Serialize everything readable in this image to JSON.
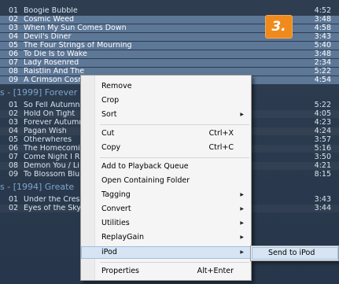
{
  "album1": {
    "tracks": [
      {
        "num": "01",
        "title": "Boogie Bubble",
        "time": "4:52"
      },
      {
        "num": "02",
        "title": "Cosmic Weed",
        "time": "3:48"
      },
      {
        "num": "03",
        "title": "When My Sun Comes Down",
        "time": "4:58"
      },
      {
        "num": "04",
        "title": "Devil's Diner",
        "time": "3:43"
      },
      {
        "num": "05",
        "title": "The Four Strings of Mourning",
        "time": "5:40"
      },
      {
        "num": "06",
        "title": "To Die Is to Wake",
        "time": "3:48"
      },
      {
        "num": "07",
        "title": "Lady Rosenred",
        "time": "2:34"
      },
      {
        "num": "08",
        "title": "Raistlin And The",
        "time": "5:22"
      },
      {
        "num": "09",
        "title": "A Crimson Cosn",
        "time": "4:54"
      }
    ]
  },
  "album2": {
    "header": "s - [1999] Forever",
    "tracks": [
      {
        "num": "01",
        "title": "So Fell Autumn",
        "time": "5:22"
      },
      {
        "num": "02",
        "title": "Hold On Tight",
        "time": "4:05"
      },
      {
        "num": "03",
        "title": "Forever Autumn",
        "time": "4:23"
      },
      {
        "num": "04",
        "title": "Pagan Wish",
        "time": "4:24"
      },
      {
        "num": "05",
        "title": "Otherwheres",
        "time": "3:57"
      },
      {
        "num": "06",
        "title": "The Homecomi",
        "time": "5:16"
      },
      {
        "num": "07",
        "title": "Come Night I R",
        "time": "3:50"
      },
      {
        "num": "08",
        "title": "Demon You / Li",
        "time": "4:21"
      },
      {
        "num": "09",
        "title": "To Blossom Blu",
        "time": "8:15"
      }
    ]
  },
  "album3": {
    "header": "s - [1994] Greate",
    "tracks": [
      {
        "num": "01",
        "title": "Under the Cresc",
        "time": "3:43"
      },
      {
        "num": "02",
        "title": "Eyes of the Sky",
        "time": "3:44"
      }
    ]
  },
  "badge": "3.",
  "context_menu": {
    "remove": "Remove",
    "crop": "Crop",
    "sort": "Sort",
    "cut": "Cut",
    "cut_shortcut": "Ctrl+X",
    "copy": "Copy",
    "copy_shortcut": "Ctrl+C",
    "add_queue": "Add to Playback Queue",
    "open_folder": "Open Containing Folder",
    "tagging": "Tagging",
    "convert": "Convert",
    "utilities": "Utilities",
    "replaygain": "ReplayGain",
    "ipod": "iPod",
    "properties": "Properties",
    "properties_shortcut": "Alt+Enter"
  },
  "submenu": {
    "send_to_ipod": "Send to iPod"
  },
  "colors": {
    "background": "#2b3a4c",
    "selected_row": "#5d7797",
    "group_header": "#7ea6cc",
    "badge": "#f08a1c",
    "menu_highlight": "#d6e4f3"
  }
}
